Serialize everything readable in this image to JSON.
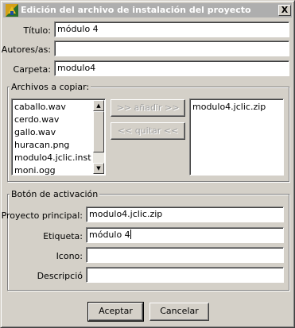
{
  "window": {
    "title": "Edición del archivo de instalación del proyecto",
    "close_symbol": "X"
  },
  "fields": {
    "titulo": {
      "label": "Título:",
      "value": "módulo 4"
    },
    "autores": {
      "label": "Autores/as:",
      "value": ""
    },
    "carpeta": {
      "label": "Carpeta:",
      "value": "modulo4"
    }
  },
  "files_group": {
    "title": "Archivos a copiar:",
    "available_files": [
      "caballo.wav",
      "cerdo.wav",
      "gallo.wav",
      "huracan.png",
      "modulo4.jclic.inst",
      "moni.ogg"
    ],
    "add_button": ">> añadir >>",
    "remove_button": "<< quitar <<",
    "selected_files": [
      "modulo4.jclic.zip"
    ]
  },
  "activation_group": {
    "title": "Botón de activación",
    "proyecto": {
      "label": "Proyecto principal:",
      "value": "modulo4.jclic.zip"
    },
    "etiqueta": {
      "label": "Etiqueta:",
      "value": "módulo 4"
    },
    "icono": {
      "label": "Icono:",
      "value": ""
    },
    "descripcio": {
      "label": "Descripció",
      "value": ""
    }
  },
  "buttons": {
    "accept": "Aceptar",
    "cancel": "Cancelar"
  },
  "icons": {
    "app": "jclic-logo-icon",
    "scroll_up": "arrow-up-icon",
    "scroll_down": "arrow-down-icon"
  },
  "colors": {
    "titlebar": "#aeaeae",
    "window_bg": "#d4d0c8",
    "field_bg": "#ffffff"
  }
}
